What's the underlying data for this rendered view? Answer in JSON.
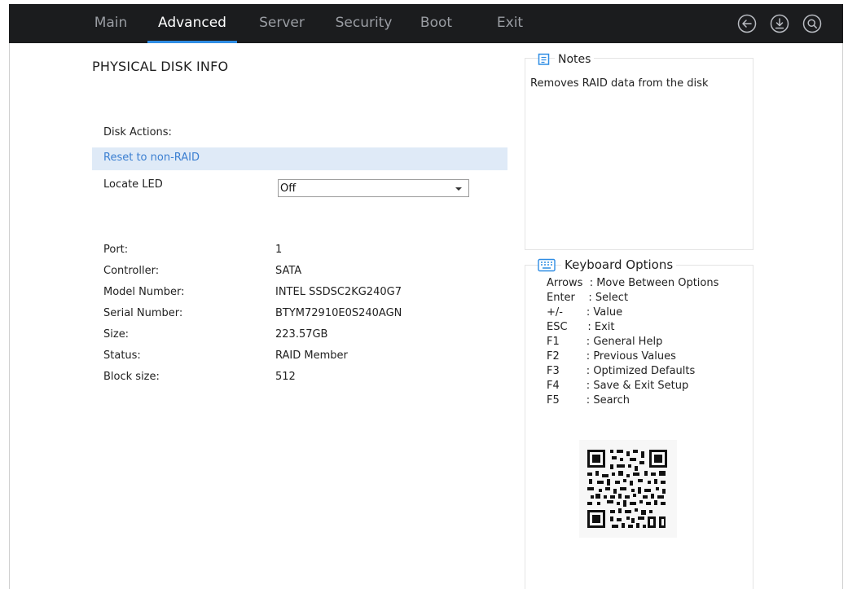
{
  "tabs": [
    {
      "label": "Main"
    },
    {
      "label": "Advanced"
    },
    {
      "label": "Server"
    },
    {
      "label": "Security"
    },
    {
      "label": "Boot"
    },
    {
      "label": "Exit"
    }
  ],
  "active_tab": "Advanced",
  "accent_color": "#2f8de4",
  "top_icons": [
    "back-arrow-icon",
    "download-icon",
    "search-icon"
  ],
  "page": {
    "title": "PHYSICAL DISK INFO",
    "disk_actions_label": "Disk Actions:",
    "reset_link": "Reset to non-RAID",
    "locate_led_label": "Locate LED",
    "locate_led_value": "Off"
  },
  "info": [
    {
      "label": "Port:",
      "value": "1"
    },
    {
      "label": "Controller:",
      "value": "SATA"
    },
    {
      "label": "Model Number:",
      "value": "INTEL SSDSC2KG240G7"
    },
    {
      "label": "Serial Number:",
      "value": "BTYM72910E0S240AGN"
    },
    {
      "label": "Size:",
      "value": "223.57GB"
    },
    {
      "label": "Status:",
      "value": "RAID Member"
    },
    {
      "label": "Block size:",
      "value": "512"
    }
  ],
  "notes": {
    "title": "Notes",
    "text": "Removes RAID data from the disk"
  },
  "keyboard": {
    "title": "Keyboard Options",
    "lines": [
      "Arrows  : Move Between Options",
      "Enter    : Select",
      "+/-       : Value",
      "ESC      : Exit",
      "F1        : General Help",
      "F2        : Previous Values",
      "F3        : Optimized Defaults",
      "F4        : Save & Exit Setup",
      "F5        : Search"
    ]
  }
}
